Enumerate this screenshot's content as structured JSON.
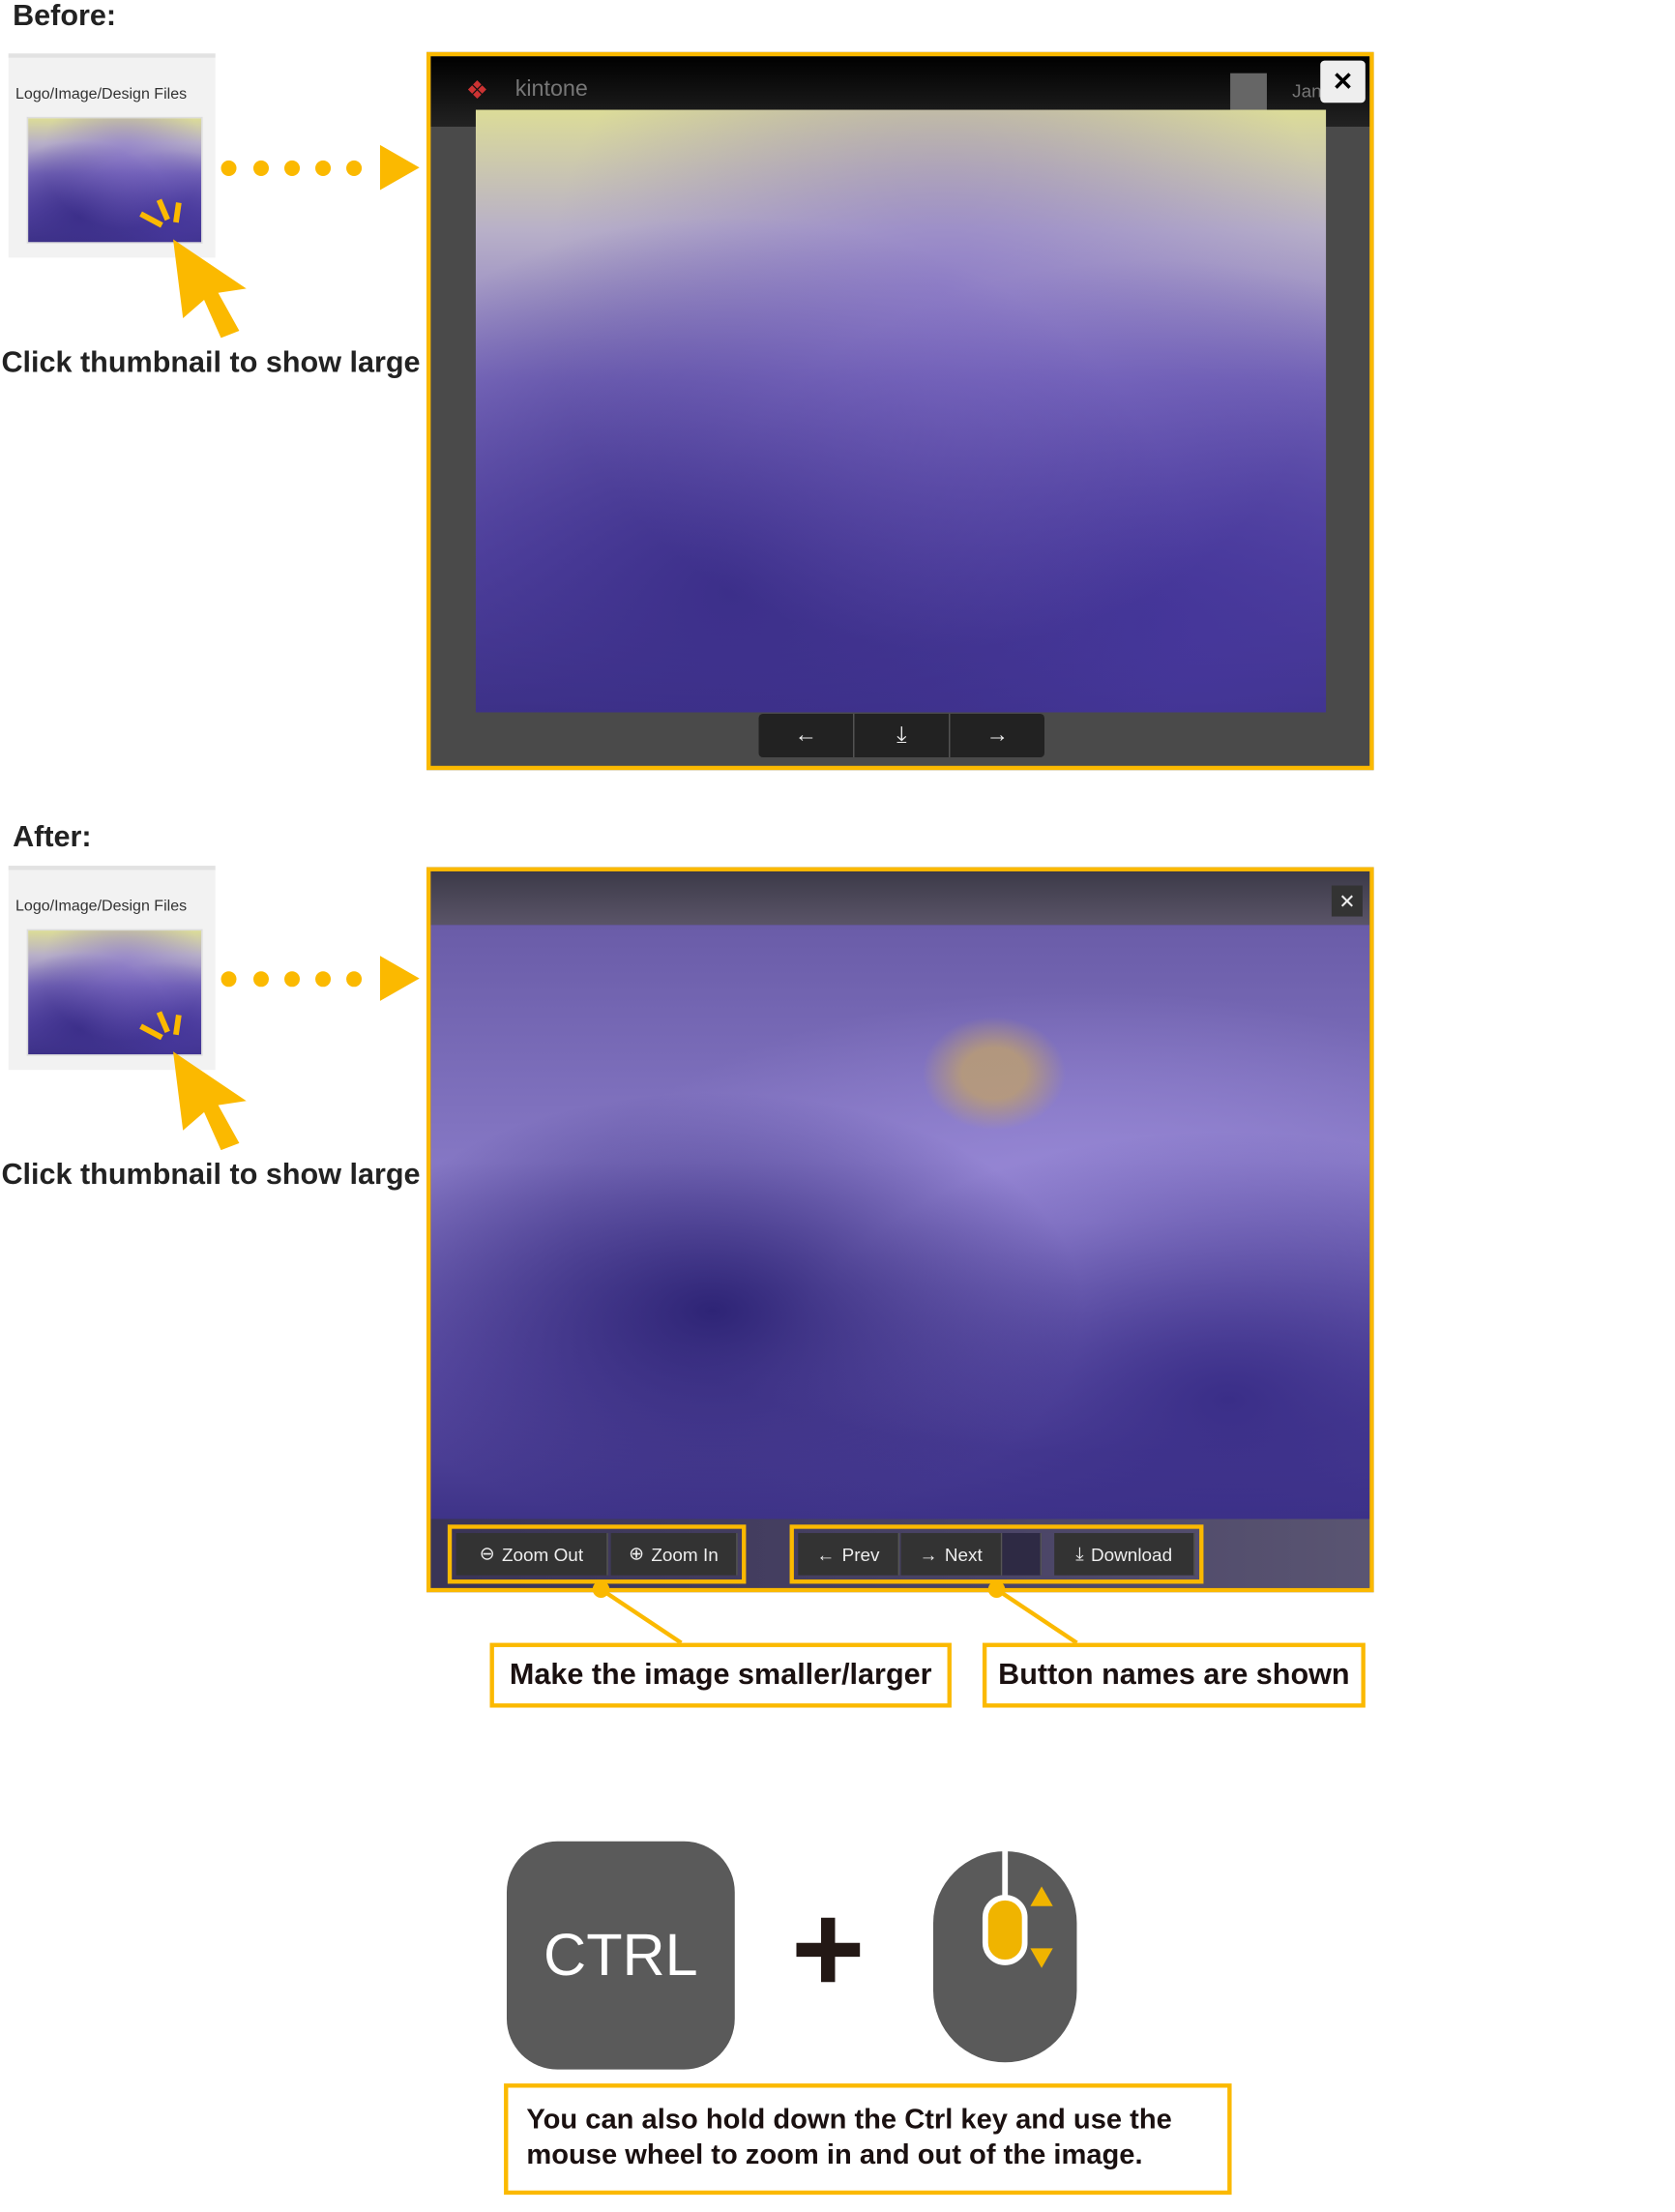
{
  "before": {
    "heading": "Before:",
    "thumb_label": "Logo/Image/Design Files",
    "caption": "Click thumbnail to show large",
    "app_name": "kintone",
    "user_name_partial": "Jan",
    "close_label": "✕",
    "buttons": [
      {
        "icon": "arrow-left-icon",
        "glyph": "←"
      },
      {
        "icon": "download-icon",
        "glyph": "⤓"
      },
      {
        "icon": "arrow-right-icon",
        "glyph": "→"
      }
    ]
  },
  "after": {
    "heading": "After:",
    "thumb_label": "Logo/Image/Design Files",
    "caption": "Click thumbnail to show large",
    "close_label": "✕",
    "zoom_buttons": [
      {
        "label": "Zoom Out",
        "glyph": "⊖"
      },
      {
        "label": "Zoom In",
        "glyph": "⊕"
      }
    ],
    "nav_buttons": [
      {
        "label": "Prev",
        "glyph": "←"
      },
      {
        "label": "Next",
        "glyph": "→"
      },
      {
        "label": "Download",
        "glyph": "⤓"
      }
    ],
    "callout_zoom": "Make the image smaller/larger",
    "callout_names": "Button names are shown"
  },
  "tip": {
    "key_label": "CTRL",
    "plus": "+",
    "text_line1": "You can also hold down the Ctrl key and use the",
    "text_line2": "mouse wheel to zoom in and out of the image."
  },
  "colors": {
    "accent": "#fbb900",
    "toolbar": "#333333"
  }
}
